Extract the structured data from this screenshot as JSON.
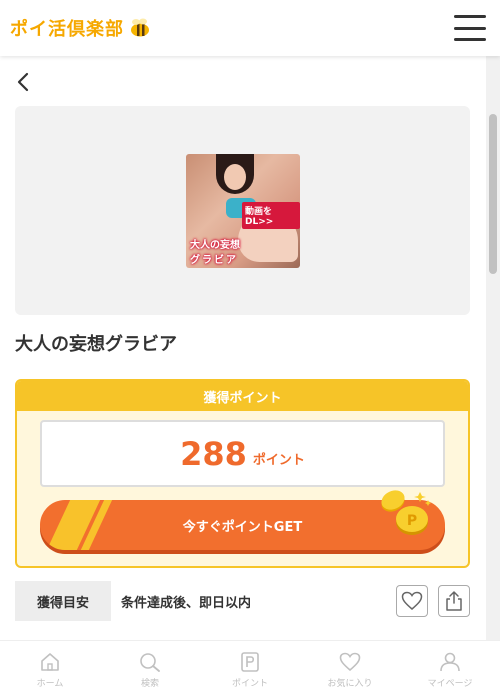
{
  "header": {
    "logo_text": "ポイ活倶楽部",
    "menu_icon": "hamburger-menu-icon"
  },
  "offer": {
    "thumbnail": {
      "dl_badge": "動画をDL>>",
      "title_line1": "大人の妄想",
      "title_line2": "グラビア"
    },
    "title": "大人の妄想グラビア"
  },
  "points": {
    "header": "獲得ポイント",
    "value": "288",
    "unit": "ポイント",
    "get_button": "今すぐポイントGET"
  },
  "estimate": {
    "label": "獲得目安",
    "value": "条件達成後、即日以内"
  },
  "tabbar": {
    "items": [
      {
        "label": "ホーム",
        "icon": "home-icon"
      },
      {
        "label": "検索",
        "icon": "search-icon"
      },
      {
        "label": "ポイント",
        "icon": "point-icon"
      },
      {
        "label": "お気に入り",
        "icon": "heart-icon"
      },
      {
        "label": "マイページ",
        "icon": "user-icon"
      }
    ]
  },
  "colors": {
    "brand_yellow": "#f6c428",
    "accent_orange": "#ef6a2c",
    "tab_inactive": "#c0c0c0"
  }
}
